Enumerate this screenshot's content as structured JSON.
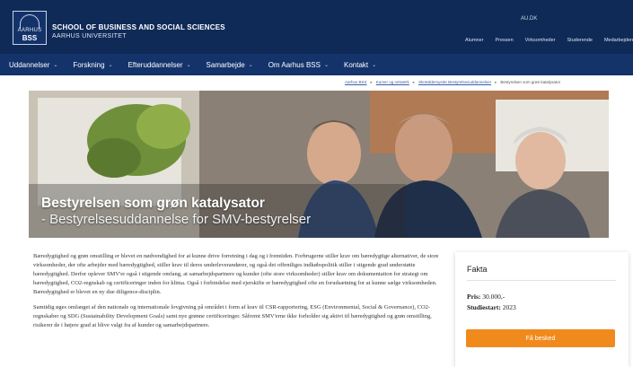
{
  "header": {
    "logo_top": "AARHUS",
    "logo_bss": "BSS",
    "school_name": "SCHOOL OF BUSINESS AND SOCIAL SCIENCES",
    "university_name": "AARHUS UNIVERSITET",
    "language_link": "AU.DK",
    "top_links": [
      "Alumner",
      "Pressen",
      "Virksomheder",
      "Studerende",
      "Medarbejdere"
    ]
  },
  "nav": {
    "items": [
      "Uddannelser",
      "Forskning",
      "Efteruddannelser",
      "Samarbejde",
      "Om Aarhus BSS",
      "Kontakt"
    ]
  },
  "breadcrumb": {
    "items": [
      "Aarhus BSS",
      "Kurser og netværk",
      "Skræddersyede Bestyrelsesuddannelser",
      "Bestyrelsen som grøn katalysator"
    ]
  },
  "hero": {
    "title": "Bestyrelsen som grøn katalysator",
    "subtitle": "- Bestyrelsesuddannelse for SMV-bestyrelser"
  },
  "content": {
    "paragraph1": "Bæredygtighed og grøn omstilling er blevet en nødvendighed for at kunne drive forretning i dag og i fremtiden. Forbrugerne stiller krav om bæredygtige alternativer, de store virksomheder, der ofte arbejder med bæredygtighed, stiller krav til deres underleverandører, og også det offentliges indkøbspolitik stiller i stigende grad understøtte bæredygtighed. Derfor oplever SMV'er også i stigende omfang, at samarbejdspartnere og kunder (ofte store virksomheder) stiller krav om dokumentation for strategi om bæredygtighed, CO2-regnskab og certificeringer inden for klima. Også i forbindelse med ejerskifte er bæredygtighed ofte en forudsætning for at kunne sælge virksomheden. Bæredygtighed er blevet en ny due diligence-disciplin.",
    "paragraph2": "Samtidig øges omfanget af den nationale og internationale lovgivning på området i form af krav til CSR-rapportering, ESG (Environmental, Social & Governance), CO2-regnskaber og SDG (Sustainability Development Goals) samt nye grønne certificeringer. Såfremt SMV'erne ikke forholder sig aktivt til bæredygtighed og grøn omstilling, risikerer de i højere grad at blive valgt fra af kunder og samarbejdspartnere."
  },
  "facts": {
    "title": "Fakta",
    "price_label": "Pris:",
    "price_value": "30.000,-",
    "start_label": "Studiestart:",
    "start_value": "2023",
    "button_label": "Få besked"
  },
  "colors": {
    "header_bg": "#0f2a57",
    "nav_bg": "#14336b",
    "accent_orange": "#f08a1c"
  }
}
